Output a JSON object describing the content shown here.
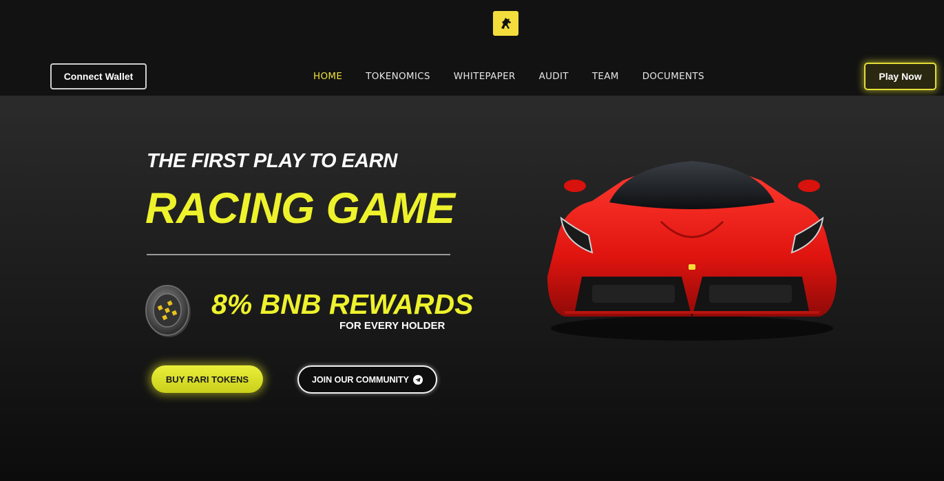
{
  "header": {
    "logo_icon": "prancing-horse-icon",
    "connect_label": "Connect Wallet",
    "play_label": "Play Now",
    "nav": [
      {
        "label": "HOME",
        "active": true
      },
      {
        "label": "TOKENOMICS",
        "active": false
      },
      {
        "label": "WHITEPAPER",
        "active": false
      },
      {
        "label": "AUDIT",
        "active": false
      },
      {
        "label": "TEAM",
        "active": false
      },
      {
        "label": "DOCUMENTS",
        "active": false
      }
    ]
  },
  "hero": {
    "pre_title": "THE FIRST PLAY TO EARN",
    "title": "RACING GAME",
    "rewards": "8% BNB REWARDS",
    "rewards_sub": "FOR EVERY HOLDER",
    "buy_label": "BUY RARI TOKENS",
    "join_label": "JOIN OUR COMMUNITY",
    "coin_icon": "bnb-coin-icon",
    "car_image": "red-sports-car"
  },
  "colors": {
    "accent": "#eef22c",
    "background": "#121212"
  }
}
